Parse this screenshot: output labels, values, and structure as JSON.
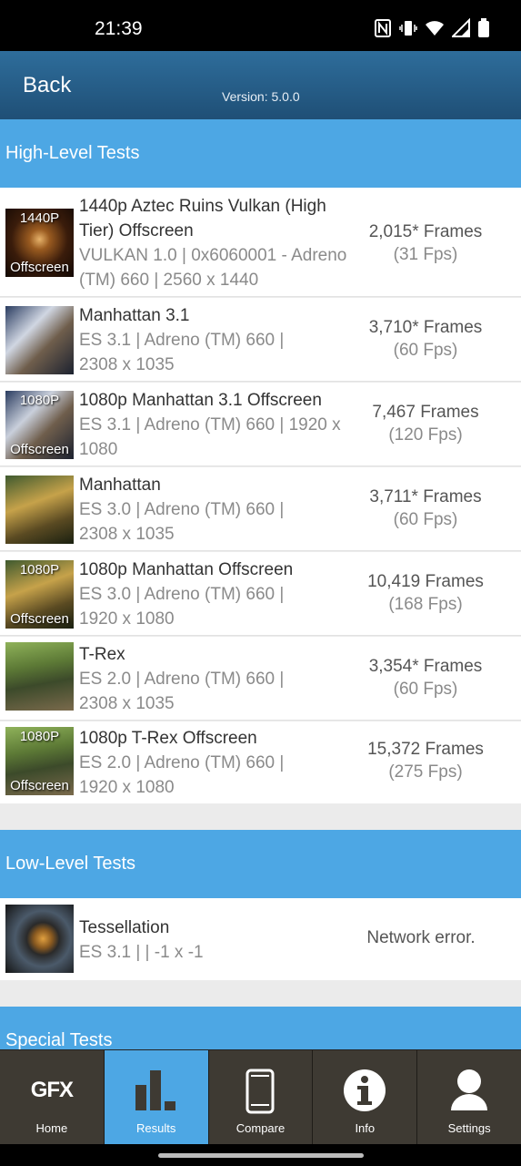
{
  "status_bar": {
    "time": "21:39",
    "icons": [
      "nfc-icon",
      "vibrate-icon",
      "wifi-icon",
      "signal-icon",
      "battery-icon"
    ]
  },
  "app_bar": {
    "back_label": "Back",
    "version": "Version: 5.0.0"
  },
  "sections": {
    "high_level": "High-Level Tests",
    "low_level": "Low-Level Tests",
    "special": "Special Tests"
  },
  "tests": [
    {
      "thumb_top": "1440P",
      "thumb_bottom": "Offscreen",
      "name": "1440p Aztec Ruins Vulkan (High Tier) Offscreen",
      "details": "VULKAN 1.0 | 0x6060001 - Adreno (TM) 660 | 2560 x 1440",
      "score": "2,015* Frames",
      "fps": "(31 Fps)"
    },
    {
      "thumb_top": "",
      "thumb_bottom": "",
      "name": "Manhattan 3.1",
      "details": "ES 3.1 | Adreno (TM) 660 | 2308 x 1035",
      "score": "3,710* Frames",
      "fps": "(60 Fps)"
    },
    {
      "thumb_top": "1080P",
      "thumb_bottom": "Offscreen",
      "name": "1080p Manhattan 3.1 Offscreen",
      "details": "ES 3.1 | Adreno (TM) 660 | 1920 x 1080",
      "score": "7,467 Frames",
      "fps": "(120 Fps)"
    },
    {
      "thumb_top": "",
      "thumb_bottom": "",
      "name": "Manhattan",
      "details": "ES 3.0 | Adreno (TM) 660 | 2308 x 1035",
      "score": "3,711* Frames",
      "fps": "(60 Fps)"
    },
    {
      "thumb_top": "1080P",
      "thumb_bottom": "Offscreen",
      "name": "1080p Manhattan Offscreen",
      "details": "ES 3.0 | Adreno (TM) 660 | 1920 x 1080",
      "score": "10,419 Frames",
      "fps": "(168 Fps)"
    },
    {
      "thumb_top": "",
      "thumb_bottom": "",
      "name": "T-Rex",
      "details": "ES 2.0 | Adreno (TM) 660 | 2308 x 1035",
      "score": "3,354* Frames",
      "fps": "(60 Fps)"
    },
    {
      "thumb_top": "1080P",
      "thumb_bottom": "Offscreen",
      "name": "1080p T-Rex Offscreen",
      "details": "ES 2.0 | Adreno (TM) 660 | 1920 x 1080",
      "score": "15,372 Frames",
      "fps": "(275 Fps)"
    }
  ],
  "low_level_tests": [
    {
      "name": "Tessellation",
      "details": "ES 3.1 |  | -1 x -1",
      "score": "Network error."
    }
  ],
  "nav": {
    "home": "Home",
    "home_logo": "GFX",
    "results": "Results",
    "compare": "Compare",
    "info": "Info",
    "settings": "Settings",
    "active": "results"
  },
  "colors": {
    "accent": "#4da7e4",
    "appbar": "#2a5f87",
    "nav_bg": "#3e3a33"
  }
}
